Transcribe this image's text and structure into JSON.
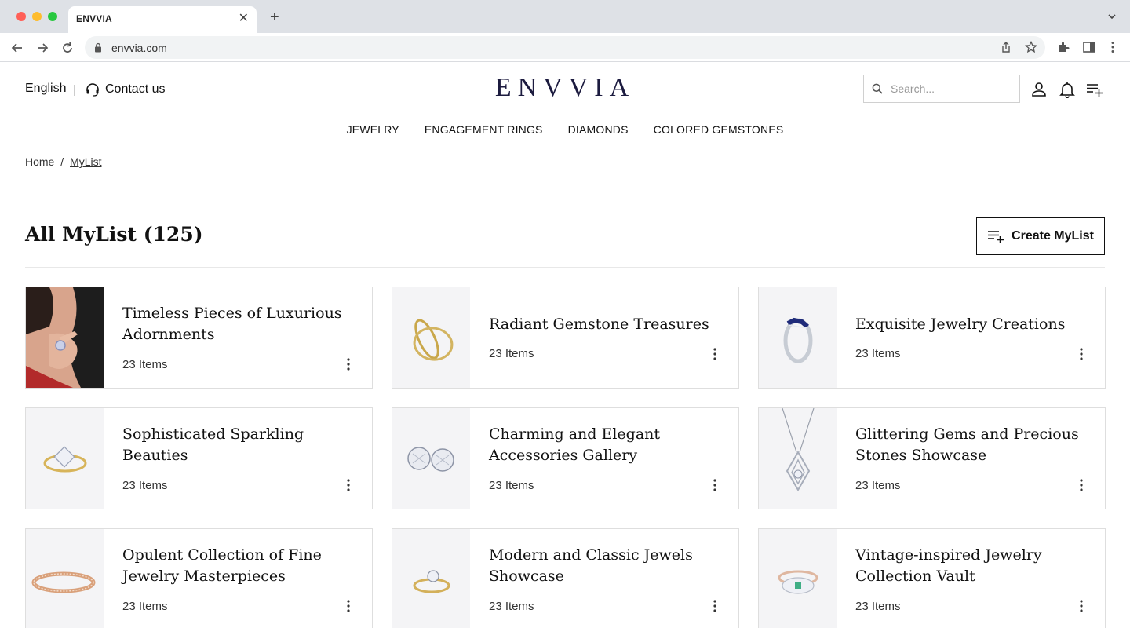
{
  "browser": {
    "tab_title": "ENVVIA",
    "url": "envvia.com",
    "icons": [
      "back-icon",
      "forward-icon",
      "reload-icon",
      "lock-icon",
      "share-icon",
      "star-icon",
      "extensions-icon",
      "side-panel-icon",
      "more-icon"
    ]
  },
  "header": {
    "language": "English",
    "contact": "Contact us",
    "logo": "ENVVIA",
    "search_placeholder": "Search...",
    "nav": [
      "JEWELRY",
      "ENGAGEMENT RINGS",
      "DIAMONDS",
      "COLORED GEMSTONES"
    ]
  },
  "breadcrumb": {
    "home": "Home",
    "separator": "/",
    "current": "MyList"
  },
  "page": {
    "title": "All MyList (125)",
    "create_button": "Create MyList"
  },
  "lists": [
    {
      "title": "Timeless Pieces of Luxurious Adornments",
      "count": "23 Items",
      "image": "model-hand-ring"
    },
    {
      "title": "Radiant Gemstone Treasures",
      "count": "23 Items",
      "image": "gold-band-pair"
    },
    {
      "title": "Exquisite Jewelry Creations",
      "count": "23 Items",
      "image": "sapphire-band"
    },
    {
      "title": "Sophisticated Sparkling Beauties",
      "count": "23 Items",
      "image": "princess-cut-ring"
    },
    {
      "title": "Charming and Elegant Accessories Gallery",
      "count": "23 Items",
      "image": "diamond-studs"
    },
    {
      "title": "Glittering Gems and Precious Stones Showcase",
      "count": "23 Items",
      "image": "diamond-pendant"
    },
    {
      "title": "Opulent Collection of Fine Jewelry Masterpieces",
      "count": "23 Items",
      "image": "rose-gold-eternity-band"
    },
    {
      "title": "Modern and Classic Jewels Showcase",
      "count": "23 Items",
      "image": "solitaire-ring"
    },
    {
      "title": "Vintage-inspired Jewelry Collection Vault",
      "count": "23 Items",
      "image": "emerald-halo-ring"
    }
  ],
  "colors": {
    "logo": "#1c1b3f",
    "thumb_bg": "#f4f4f6",
    "border": "#dedede"
  }
}
